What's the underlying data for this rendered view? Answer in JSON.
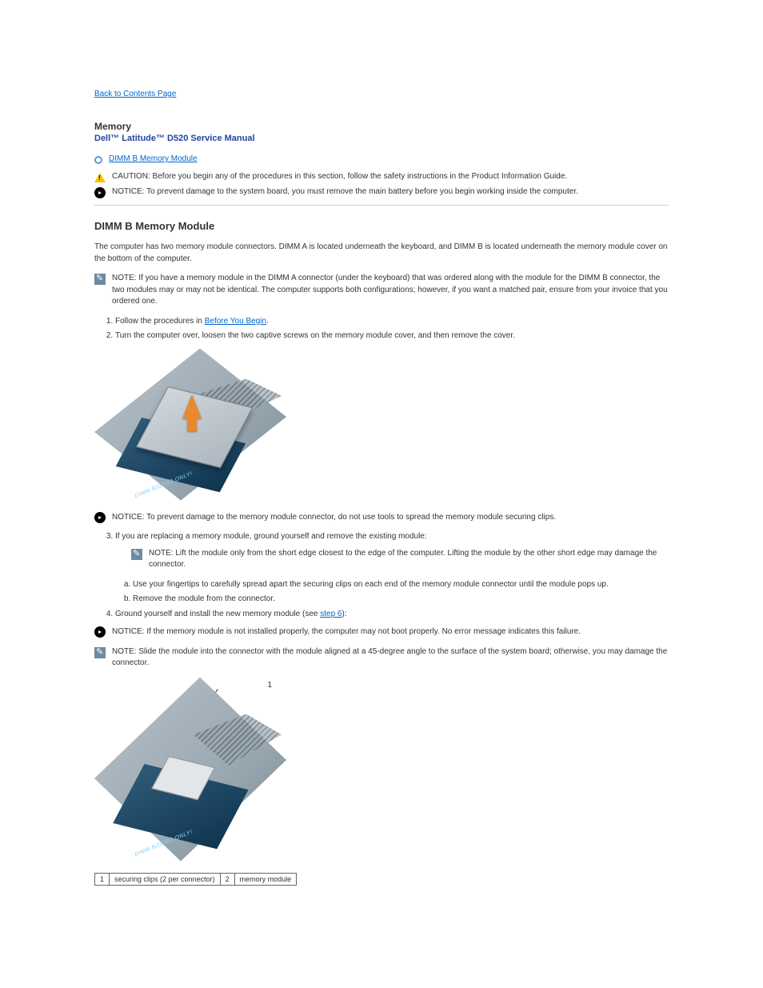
{
  "back_link": "Back to Contents Page",
  "section": {
    "title": "Memory",
    "subtitle": "Dell™ Latitude™ D520 Service Manual"
  },
  "toc_link": "DIMM B Memory Module",
  "caution_line": "CAUTION: Before you begin any of the procedures in this section, follow the safety instructions in the Product Information Guide.",
  "notice_line": "NOTICE: To prevent damage to the system board, you must remove the main battery before you begin working inside the computer.",
  "dimm_b_heading": "DIMM B Memory Module",
  "para_intro": "The computer has two memory module connectors. DIMM A is located underneath the keyboard, and DIMM B is located underneath the memory module cover on the bottom of the computer.",
  "note_matched_pair": "NOTE: If you have a memory module in the DIMM A connector (under the keyboard) that was ordered along with the module for the DIMM B connector, the two modules may or may not be identical. The computer supports both configurations; however, if you want a matched pair, ensure from your invoice that you ordered one.",
  "steps_1": [
    {
      "1": "Follow the procedures in ",
      "link": "Before You Begin",
      "2": "."
    },
    {
      "1": "Turn the computer over, loosen the two captive screws on the memory module cover, and then remove the cover."
    }
  ],
  "notice_tools": "NOTICE: To prevent damage to the memory module connector, do not use tools to spread the memory module securing clips.",
  "step_3_intro": "If you are replacing a memory module, ground yourself and remove the existing module:",
  "step_3_sub": [
    "Use your fingertips to carefully spread apart the securing clips on each end of the memory module connector until the module pops up.",
    "Remove the module from the connector."
  ],
  "note_lift": "NOTE: Lift the module only from the short edge closest to the edge of the computer. Lifting the module by the other short edge may damage the connector.",
  "step_4": {
    "1": "Ground yourself and install the new memory module (see ",
    "link": "step 6",
    "2": "):"
  },
  "notice_not_seated": "NOTICE: If the memory module is not installed properly, the computer may not boot properly. No error message indicates this failure.",
  "note_45deg": "NOTE: Slide the module into the connector with the module aligned at a 45-degree angle to the surface of the system board; otherwise, you may damage the connector.",
  "img1_label": "DIMM B/DDR2 ONLY!",
  "img2_label": "DIMM B/DDR2 ONLY!",
  "callout_1": "1",
  "table": {
    "c1": "1",
    "c2": "securing clips (2 per connector)",
    "c3": "2",
    "c4": "memory module"
  }
}
